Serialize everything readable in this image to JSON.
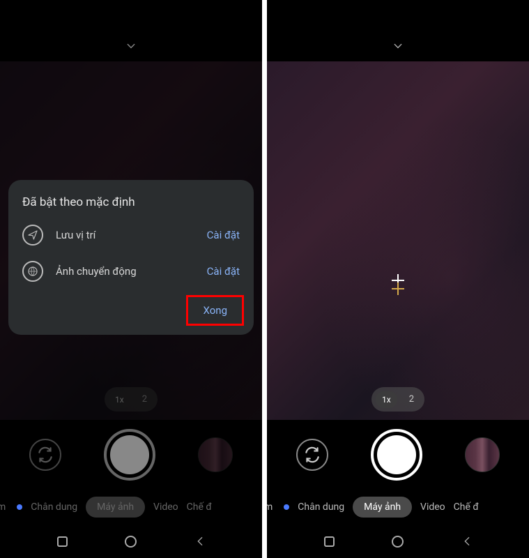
{
  "dialog": {
    "title": "Đã bật theo mặc định",
    "rows": [
      {
        "label": "Lưu vị trí",
        "action": "Cài đặt"
      },
      {
        "label": "Ảnh chuyển động",
        "action": "Cài đặt"
      }
    ],
    "done": "Xong"
  },
  "zoom": {
    "active": "1x",
    "option": "2"
  },
  "modes": {
    "partial_left": "m",
    "portrait": "Chân dung",
    "camera": "Máy ảnh",
    "video": "Video",
    "partial_right": "Chế đ"
  }
}
